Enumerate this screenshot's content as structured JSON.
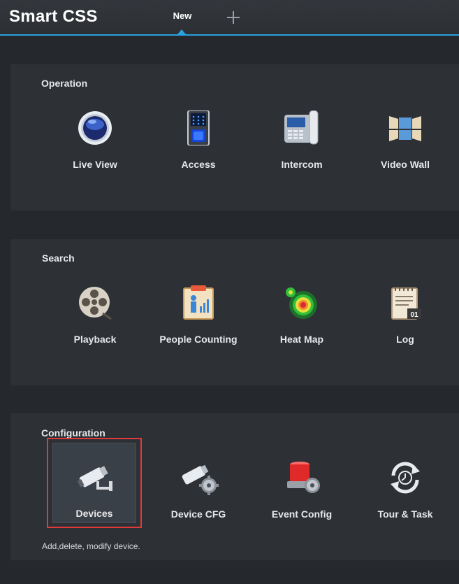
{
  "app": {
    "title": "Smart CSS"
  },
  "tabs": [
    {
      "label": "New",
      "active": true
    }
  ],
  "add_tab_icon": "plus-icon",
  "colors": {
    "accent": "#2aa0e0",
    "selection": "#e03a3a",
    "background": "#25282c",
    "panel": "#2d3035"
  },
  "sections": [
    {
      "title": "Operation",
      "items": [
        {
          "label": "Live View",
          "icon": "live-view-icon"
        },
        {
          "label": "Access",
          "icon": "access-icon"
        },
        {
          "label": "Intercom",
          "icon": "intercom-icon"
        },
        {
          "label": "Video Wall",
          "icon": "video-wall-icon"
        }
      ]
    },
    {
      "title": "Search",
      "items": [
        {
          "label": "Playback",
          "icon": "playback-icon"
        },
        {
          "label": "People Counting",
          "icon": "people-counting-icon"
        },
        {
          "label": "Heat Map",
          "icon": "heat-map-icon"
        },
        {
          "label": "Log",
          "icon": "log-icon"
        }
      ]
    },
    {
      "title": "Configuration",
      "items": [
        {
          "label": "Devices",
          "icon": "devices-icon",
          "selected": true
        },
        {
          "label": "Device CFG",
          "icon": "device-cfg-icon"
        },
        {
          "label": "Event Config",
          "icon": "event-config-icon"
        },
        {
          "label": "Tour & Task",
          "icon": "tour-task-icon"
        }
      ],
      "help_text": "Add,delete, modify device."
    }
  ],
  "log_icon_text": "01"
}
